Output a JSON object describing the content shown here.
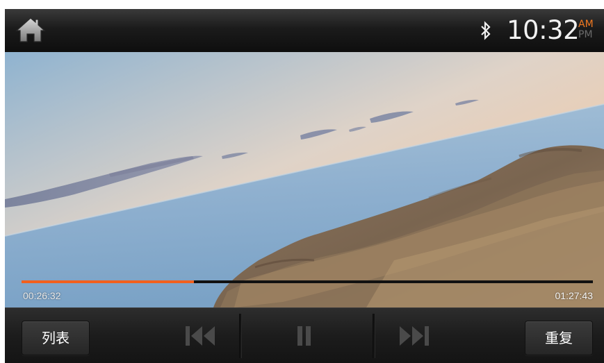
{
  "status_bar": {
    "home_icon": "home-icon",
    "bluetooth_icon": "bluetooth-icon",
    "time": "10:32",
    "am": "AM",
    "pm": "PM",
    "active_period": "AM"
  },
  "player": {
    "elapsed": "00:26:32",
    "total": "01:27:43",
    "progress_fraction": 0.302
  },
  "controls": {
    "list_label": "列表",
    "repeat_label": "重复",
    "prev_icon": "skip-previous-icon",
    "pause_icon": "pause-icon",
    "next_icon": "skip-next-icon"
  },
  "colors": {
    "accent": "#f2601e",
    "am_active": "#f07820",
    "pm_inactive": "#6a6a6a"
  }
}
